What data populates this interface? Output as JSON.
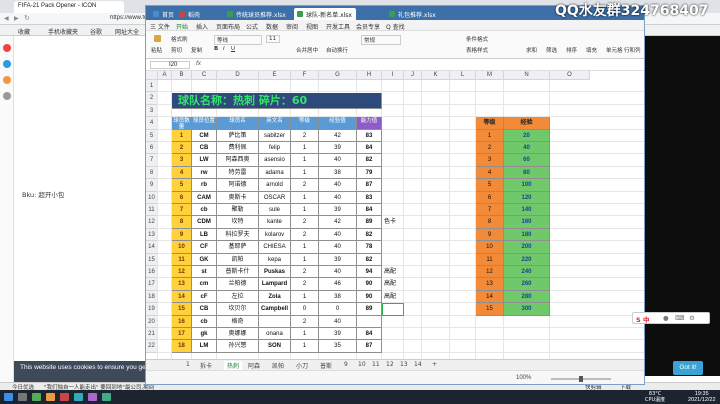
{
  "browser": {
    "tab_title": "FIFA-21 Pack Opener - ICON",
    "url": "https://www.futbin",
    "bookmarks": [
      "收藏",
      "手机收藏夹",
      "谷歌",
      "网址大全",
      "360搜索",
      "游戏中心"
    ],
    "sidebar_label": "Bku: 超开小包",
    "cookie_text": "This website uses cookies to ensure you get th",
    "got_it": "Got it!",
    "status_left": "今日优选",
    "status_news": "\"我们独自一人能走出\" 要回到地\"最公司,期间回到了旅途",
    "status_right": [
      "快剪辑",
      "下载"
    ]
  },
  "wps": {
    "tabs": [
      "首页",
      "稻壳",
      "传统球员推荐.xlsx",
      "球队-新名单.xlsx",
      "礼包推荐.xlsx"
    ],
    "active_tab": 3,
    "menu": [
      "三 文件",
      "开始",
      "插入",
      "页面布局",
      "公式",
      "数据",
      "审阅",
      "视图",
      "开发工具",
      "会员专享",
      "Q 查找"
    ],
    "ribbon": {
      "clipboard": [
        "粘贴",
        "格式刷",
        "剪切",
        "复制"
      ],
      "font_name": "等线",
      "font_size": "11",
      "align_buttons": [
        "合并居中",
        "自动换行"
      ],
      "number_format": "常规",
      "right_buttons": [
        "条件格式",
        "表格样式",
        "求和",
        "筛选",
        "排序",
        "填充",
        "单元格",
        "行和列",
        "工作表"
      ]
    },
    "namebox": "I20",
    "fx": "fx",
    "columns": [
      "A",
      "B",
      "C",
      "D",
      "E",
      "F",
      "G",
      "H",
      "I",
      "J",
      "K",
      "L",
      "M",
      "N",
      "O"
    ],
    "row_numbers": [
      "1",
      "2",
      "3",
      "4",
      "5",
      "6",
      "7",
      "8",
      "9",
      "10",
      "11",
      "12",
      "13",
      "14",
      "15",
      "16",
      "17",
      "18",
      "19",
      "20",
      "21",
      "22",
      "23",
      "24",
      "25",
      "26"
    ]
  },
  "sheet": {
    "title": "球队名称：热刺   碎片：60",
    "headers": [
      "球员数量",
      "球员位置",
      "球员名",
      "英文名",
      "等级",
      "经验值",
      "能力值"
    ],
    "rows": [
      {
        "n": "1",
        "pos": "CM",
        "cn": "萨比策",
        "en": "sabitzer",
        "lv": "2",
        "exp": "42",
        "ovr": "83",
        "note": ""
      },
      {
        "n": "2",
        "pos": "CB",
        "cn": "费利佩",
        "en": "felip",
        "lv": "1",
        "exp": "39",
        "ovr": "84",
        "note": ""
      },
      {
        "n": "3",
        "pos": "LW",
        "cn": "阿森西奥",
        "en": "asensio",
        "lv": "1",
        "exp": "40",
        "ovr": "82",
        "note": ""
      },
      {
        "n": "4",
        "pos": "rw",
        "cn": "特劳雷",
        "en": "adama",
        "lv": "1",
        "exp": "38",
        "ovr": "79",
        "note": ""
      },
      {
        "n": "5",
        "pos": "rb",
        "cn": "阿诺德",
        "en": "arnold",
        "lv": "2",
        "exp": "40",
        "ovr": "87",
        "note": ""
      },
      {
        "n": "6",
        "pos": "CAM",
        "cn": "奥斯卡",
        "en": "OSCAR",
        "lv": "1",
        "exp": "40",
        "ovr": "83",
        "note": ""
      },
      {
        "n": "7",
        "pos": "cb",
        "cn": "聚勒",
        "en": "sule",
        "lv": "1",
        "exp": "39",
        "ovr": "84",
        "note": ""
      },
      {
        "n": "8",
        "pos": "CDM",
        "cn": "坎特",
        "en": "kante",
        "lv": "2",
        "exp": "42",
        "ovr": "89",
        "note": "色卡"
      },
      {
        "n": "9",
        "pos": "LB",
        "cn": "科拉罗夫",
        "en": "kolarov",
        "lv": "2",
        "exp": "40",
        "ovr": "82",
        "note": ""
      },
      {
        "n": "10",
        "pos": "CF",
        "cn": "基耶萨",
        "en": "CHIESA",
        "lv": "1",
        "exp": "40",
        "ovr": "78",
        "note": ""
      },
      {
        "n": "11",
        "pos": "GK",
        "cn": "凯帕",
        "en": "kepa",
        "lv": "1",
        "exp": "39",
        "ovr": "82",
        "note": ""
      },
      {
        "n": "12",
        "pos": "st",
        "cn": "普斯卡什",
        "en": "Puskas",
        "lv": "2",
        "exp": "40",
        "ovr": "94",
        "note": "高配"
      },
      {
        "n": "13",
        "pos": "cm",
        "cn": "兰帕德",
        "en": "Lampard",
        "lv": "2",
        "exp": "46",
        "ovr": "90",
        "note": "高配"
      },
      {
        "n": "14",
        "pos": "cF",
        "cn": "左拉",
        "en": "Zola",
        "lv": "1",
        "exp": "38",
        "ovr": "90",
        "note": "高配"
      },
      {
        "n": "15",
        "pos": "CB",
        "cn": "坎贝尔",
        "en": "Campbell",
        "lv": "0",
        "exp": "0",
        "ovr": "89",
        "note": ""
      },
      {
        "n": "16",
        "pos": "cb",
        "cn": "格奇",
        "en": "",
        "lv": "2",
        "exp": "40",
        "ovr": "",
        "note": ""
      },
      {
        "n": "17",
        "pos": "gk",
        "cn": "奥娜娜",
        "en": "onana",
        "lv": "1",
        "exp": "39",
        "ovr": "84",
        "note": ""
      },
      {
        "n": "18",
        "pos": "LM",
        "cn": "孙兴慜",
        "en": "SON",
        "lv": "1",
        "exp": "35",
        "ovr": "87",
        "note": ""
      },
      {
        "n": "19",
        "pos": "",
        "cn": "",
        "en": "",
        "lv": "",
        "exp": "",
        "ovr": "",
        "note": ""
      }
    ],
    "ref_headers": [
      "等级",
      "经验"
    ],
    "ref_rows": [
      {
        "lv": "1",
        "exp": "20"
      },
      {
        "lv": "2",
        "exp": "40"
      },
      {
        "lv": "3",
        "exp": "60"
      },
      {
        "lv": "4",
        "exp": "80"
      },
      {
        "lv": "5",
        "exp": "100"
      },
      {
        "lv": "6",
        "exp": "120"
      },
      {
        "lv": "7",
        "exp": "140"
      },
      {
        "lv": "8",
        "exp": "160"
      },
      {
        "lv": "9",
        "exp": "180"
      },
      {
        "lv": "10",
        "exp": "200"
      },
      {
        "lv": "11",
        "exp": "220"
      },
      {
        "lv": "12",
        "exp": "240"
      },
      {
        "lv": "13",
        "exp": "260"
      },
      {
        "lv": "14",
        "exp": "280"
      },
      {
        "lv": "15",
        "exp": "300"
      }
    ],
    "sheet_tabs": [
      "1",
      "拆卡",
      "热刺",
      "阿森",
      "凯帕",
      "小刀",
      "普斯",
      "9",
      "10",
      "11",
      "12",
      "13",
      "14"
    ],
    "active_sheet": 2,
    "status_zoom": "100%"
  },
  "overlay": {
    "qq_text": "QQ水友群324768407",
    "ime_label": "S 中"
  },
  "taskbar": {
    "tray": [
      "83°C",
      "CPU温度"
    ],
    "time": "19:35",
    "date": "2021/12/22"
  },
  "colors": {
    "title_bg": "#2e4a7c",
    "title_text": "#33e56a",
    "index_yellow": "#ffd13b",
    "header_blue": "#5b9bd5",
    "ref_orange": "#f28a38",
    "ref_green": "#6fc86a"
  }
}
